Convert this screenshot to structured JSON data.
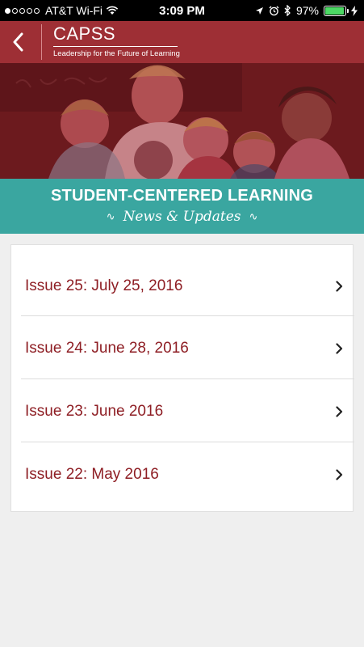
{
  "status_bar": {
    "carrier": "AT&T Wi-Fi",
    "time": "3:09 PM",
    "battery": "97%",
    "battery_level": 0.97,
    "icons": [
      "signal-dots-icon",
      "wifi-icon",
      "location-icon",
      "alarm-icon",
      "bluetooth-icon",
      "battery-icon",
      "charging-icon"
    ]
  },
  "header": {
    "back_icon": "chevron-left-icon",
    "brand": "CAPSS",
    "tagline": "Leadership for the Future of Learning"
  },
  "banner": {
    "title": "STUDENT-CENTERED LEARNING",
    "subtitle": "News & Updates"
  },
  "issues": [
    {
      "label": "Issue 25: July 25, 2016"
    },
    {
      "label": "Issue 24: June 28, 2016"
    },
    {
      "label": "Issue 23: June 2016"
    },
    {
      "label": "Issue 22: May 2016"
    }
  ],
  "colors": {
    "header": "#9e2f35",
    "banner": "#3aa6a0",
    "issue_text": "#8e1e24",
    "background": "#efefef"
  }
}
